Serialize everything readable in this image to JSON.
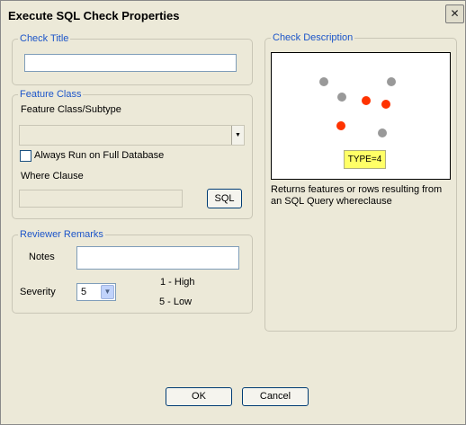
{
  "window": {
    "title": "Execute SQL Check Properties",
    "close_glyph": "✕"
  },
  "check_title": {
    "legend": "Check Title",
    "value": ""
  },
  "feature_class": {
    "legend": "Feature Class",
    "subtype_label": "Feature Class/Subtype",
    "subtype_value": "",
    "always_run_label": "Always Run on Full Database",
    "always_run_checked": false,
    "where_clause_label": "Where Clause",
    "where_clause_value": "",
    "sql_button": "SQL"
  },
  "reviewer_remarks": {
    "legend": "Reviewer Remarks",
    "notes_label": "Notes",
    "notes_value": "",
    "severity_label": "Severity",
    "severity_value": "5",
    "severity_high": "1 - High",
    "severity_low": "5 - Low"
  },
  "check_description": {
    "legend": "Check Description",
    "type_tag": "TYPE=4",
    "text": "Returns features or rows resulting from an SQL Query whereclause",
    "colors": {
      "gray_point": "#999999",
      "red_point": "#ff3300",
      "tag_background": "#ffff66"
    }
  },
  "footer": {
    "ok_button": "OK",
    "cancel_button": "Cancel"
  }
}
